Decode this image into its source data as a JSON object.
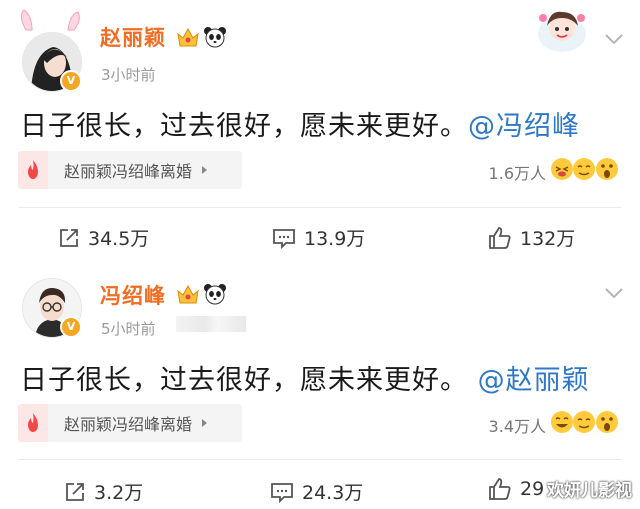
{
  "posts": [
    {
      "username": "赵丽颖",
      "time": "3小时前",
      "content_text": "日子很长，过去很好，愿未来更好。",
      "mention": "@冯绍峰",
      "topic": "赵丽颖冯绍峰离婚",
      "reaction_count": "1.6万人",
      "actions": {
        "repost": "34.5万",
        "comment": "13.9万",
        "like": "132万"
      }
    },
    {
      "username": "冯绍峰",
      "time": "5小时前",
      "content_text": "日子很长，过去很好，愿未来更好。",
      "mention": "@赵丽颖",
      "topic": "赵丽颖冯绍峰离婚",
      "reaction_count": "3.4万人",
      "actions": {
        "repost": "3.2万",
        "comment": "24.3万",
        "like": "29"
      }
    }
  ],
  "watermark": "欢妍儿影视",
  "icons": {
    "verified_badge": "verified-badge-icon",
    "crown": "crown-icon",
    "panda": "panda-icon",
    "chevron": "chevron-down-icon",
    "fire": "fire-icon",
    "repost": "share-icon",
    "comment": "comment-icon",
    "like": "thumbs-up-icon"
  },
  "colors": {
    "username": "#f26c22",
    "mention": "#2e78c7",
    "badge": "#f5a623"
  }
}
